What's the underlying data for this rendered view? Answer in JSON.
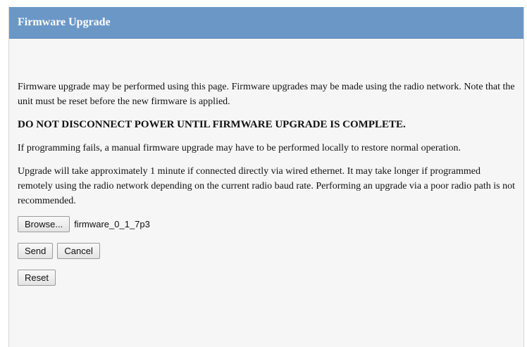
{
  "header": {
    "title": "Firmware Upgrade"
  },
  "content": {
    "intro": "Firmware upgrade may be performed using this page. Firmware upgrades may be made using the radio network. Note that the unit must be reset before the new firmware is applied.",
    "warning": "DO NOT DISCONNECT POWER UNTIL FIRMWARE UPGRADE IS COMPLETE.",
    "fail_note": "If programming fails, a manual firmware upgrade may have to be performed locally to restore normal operation.",
    "time_note": "Upgrade will take approximately 1 minute if connected directly via wired ethernet. It may take longer if programmed remotely using the radio network depending on the current radio baud rate. Performing an upgrade via a poor radio path is not recommended."
  },
  "file_picker": {
    "browse_label": "Browse...",
    "selected_file": "firmware_0_1_7p3"
  },
  "actions": {
    "send_label": "Send",
    "cancel_label": "Cancel",
    "reset_label": "Reset"
  }
}
